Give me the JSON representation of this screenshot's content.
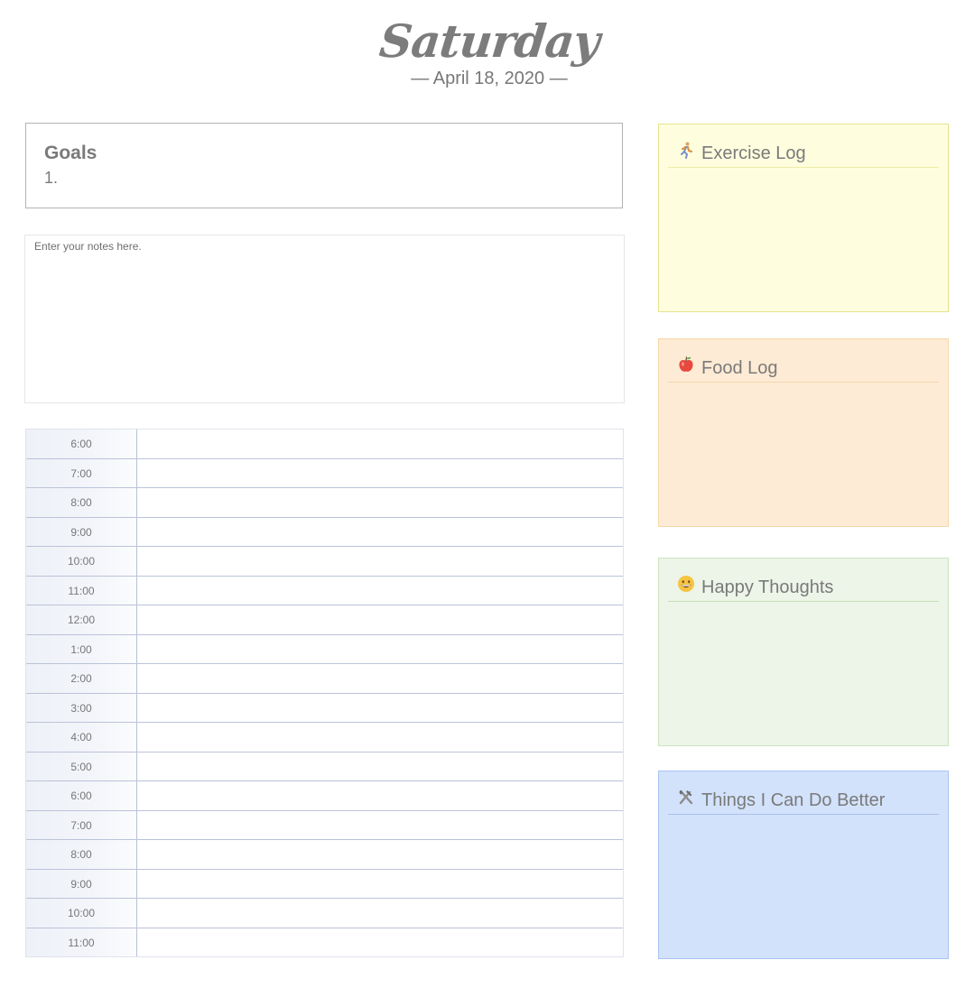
{
  "header": {
    "day": "Saturday",
    "date": "— April 18, 2020 —"
  },
  "goals": {
    "title": "Goals",
    "items": [
      "1."
    ]
  },
  "notes": {
    "placeholder": "Enter your notes here.",
    "value": ""
  },
  "schedule": {
    "times": [
      "6:00",
      "7:00",
      "8:00",
      "9:00",
      "10:00",
      "11:00",
      "12:00",
      "1:00",
      "2:00",
      "3:00",
      "4:00",
      "5:00",
      "6:00",
      "7:00",
      "8:00",
      "9:00",
      "10:00",
      "11:00"
    ]
  },
  "logs": {
    "exercise": {
      "title": "Exercise Log",
      "icon": "running-person-icon"
    },
    "food": {
      "title": "Food Log",
      "icon": "apple-icon"
    },
    "happy": {
      "title": "Happy Thoughts",
      "icon": "smiling-face-icon"
    },
    "better": {
      "title": "Things I Can Do Better",
      "icon": "hammer-wrench-icon"
    }
  },
  "colors": {
    "exercise_bg": "#fefedf",
    "food_bg": "#feebd5",
    "happy_bg": "#edf4e8",
    "better_bg": "#d3e2fb",
    "text": "#7a7a7a"
  }
}
